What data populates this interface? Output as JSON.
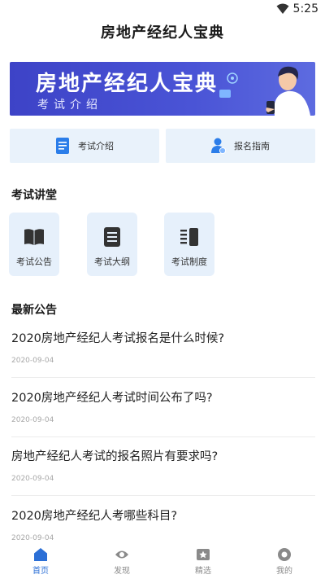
{
  "status_bar": {
    "time": "5:25",
    "wifi_icon": "wifi-icon"
  },
  "app_title": "房地产经纪人宝典",
  "banner": {
    "title": "房地产经纪人宝典",
    "subtitle": "考试介绍"
  },
  "quick_cards": [
    {
      "label": "考试介绍",
      "icon": "document-icon"
    },
    {
      "label": "报名指南",
      "icon": "user-badge-icon"
    }
  ],
  "section_lectures": {
    "title": "考试讲堂",
    "tiles": [
      {
        "label": "考试公告",
        "icon": "book-icon"
      },
      {
        "label": "考试大纲",
        "icon": "outline-icon"
      },
      {
        "label": "考试制度",
        "icon": "rules-icon"
      }
    ]
  },
  "section_news": {
    "title": "最新公告",
    "items": [
      {
        "title": "2020房地产经纪人考试报名是什么时候?",
        "date": "2020-09-04"
      },
      {
        "title": "2020房地产经纪人考试时间公布了吗?",
        "date": "2020-09-04"
      },
      {
        "title": "房地产经纪人考试的报名照片有要求吗?",
        "date": "2020-09-04"
      },
      {
        "title": "2020房地产经纪人考哪些科目?",
        "date": "2020-09-04"
      }
    ]
  },
  "tabbar": {
    "active_color": "#2b6fd6",
    "tabs": [
      {
        "label": "首页",
        "icon": "home-icon",
        "active": true
      },
      {
        "label": "发现",
        "icon": "eye-icon",
        "active": false
      },
      {
        "label": "精选",
        "icon": "star-badge-icon",
        "active": false
      },
      {
        "label": "我的",
        "icon": "profile-icon",
        "active": false
      }
    ]
  }
}
